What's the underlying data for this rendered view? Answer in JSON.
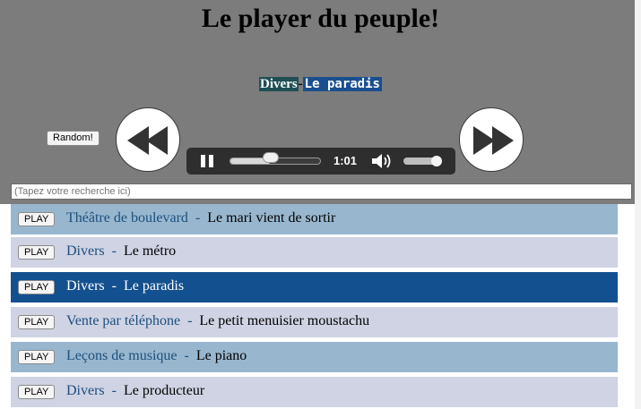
{
  "app": {
    "title": "Le player du peuple!"
  },
  "now_playing": {
    "artist": "Divers",
    "separator": "-",
    "title": "Le paradis"
  },
  "controls": {
    "random_label": "Random!",
    "time": "1:01",
    "progress_fraction": 0.45,
    "volume_fraction": 0.85
  },
  "search": {
    "placeholder": "(Tapez votre recherche ici)"
  },
  "colors": {
    "header_bg": "#7c7c7c",
    "row_light_blue": "#98b7cf",
    "row_lavender": "#cfd3e3",
    "row_active": "#13508f",
    "category_text": "#1d4f7d"
  },
  "tracks": [
    {
      "play": "PLAY",
      "category": "Théâtre de boulevard",
      "dash": "-",
      "title": "Le mari vient de sortir",
      "active": false
    },
    {
      "play": "PLAY",
      "category": "Divers",
      "dash": "-",
      "title": "Le métro",
      "active": false
    },
    {
      "play": "PLAY",
      "category": "Divers",
      "dash": "-",
      "title": "Le paradis",
      "active": true
    },
    {
      "play": "PLAY",
      "category": "Vente par téléphone",
      "dash": "-",
      "title": "Le petit menuisier moustachu",
      "active": false
    },
    {
      "play": "PLAY",
      "category": "Leçons de musique",
      "dash": "-",
      "title": "Le piano",
      "active": false
    },
    {
      "play": "PLAY",
      "category": "Divers",
      "dash": "-",
      "title": "Le producteur",
      "active": false
    }
  ]
}
